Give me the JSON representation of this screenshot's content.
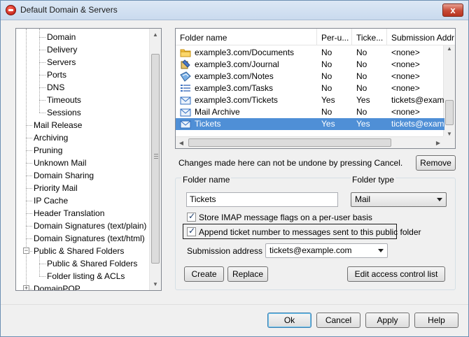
{
  "window": {
    "title": "Default Domain & Servers",
    "close_glyph": "x"
  },
  "tree": {
    "items": [
      {
        "label": "Domain",
        "level": 2
      },
      {
        "label": "Delivery",
        "level": 2
      },
      {
        "label": "Servers",
        "level": 2
      },
      {
        "label": "Ports",
        "level": 2
      },
      {
        "label": "DNS",
        "level": 2
      },
      {
        "label": "Timeouts",
        "level": 2
      },
      {
        "label": "Sessions",
        "level": 2
      },
      {
        "label": "Mail Release",
        "level": 1
      },
      {
        "label": "Archiving",
        "level": 1
      },
      {
        "label": "Pruning",
        "level": 1
      },
      {
        "label": "Unknown Mail",
        "level": 1
      },
      {
        "label": "Domain Sharing",
        "level": 1
      },
      {
        "label": "Priority Mail",
        "level": 1
      },
      {
        "label": "IP Cache",
        "level": 1
      },
      {
        "label": "Header Translation",
        "level": 1
      },
      {
        "label": "Domain Signatures (text/plain)",
        "level": 1
      },
      {
        "label": "Domain Signatures (text/html)",
        "level": 1
      },
      {
        "label": "Public & Shared Folders",
        "level": 1
      },
      {
        "label": "Public & Shared Folders",
        "level": 2
      },
      {
        "label": "Folder listing & ACLs",
        "level": 2
      },
      {
        "label": "DomainPOP",
        "level": 1
      }
    ],
    "expanders": {
      "collapse": "−",
      "expand": "+"
    }
  },
  "folders": {
    "columns": [
      "Folder name",
      "Per-u...",
      "Ticke...",
      "Submission Addr"
    ],
    "rows": [
      {
        "icon": "folder-icon",
        "name": "example3.com/Documents",
        "per_user": "No",
        "ticket": "No",
        "submission": "<none>"
      },
      {
        "icon": "journal-icon",
        "name": "example3.com/Journal",
        "per_user": "No",
        "ticket": "No",
        "submission": "<none>"
      },
      {
        "icon": "notes-icon",
        "name": "example3.com/Notes",
        "per_user": "No",
        "ticket": "No",
        "submission": "<none>"
      },
      {
        "icon": "tasks-icon",
        "name": "example3.com/Tasks",
        "per_user": "No",
        "ticket": "No",
        "submission": "<none>"
      },
      {
        "icon": "mail-icon",
        "name": "example3.com/Tickets",
        "per_user": "Yes",
        "ticket": "Yes",
        "submission": "tickets@example"
      },
      {
        "icon": "mail-icon",
        "name": "Mail Archive",
        "per_user": "No",
        "ticket": "No",
        "submission": "<none>"
      },
      {
        "icon": "mail-icon",
        "name": "Tickets",
        "per_user": "Yes",
        "ticket": "Yes",
        "submission": "tickets@example",
        "selected": true
      }
    ]
  },
  "warning_text": "Changes made here can not be undone by pressing Cancel.",
  "buttons": {
    "remove": "Remove",
    "create": "Create",
    "replace": "Replace",
    "edit_acl": "Edit access control list",
    "ok": "Ok",
    "cancel": "Cancel",
    "apply": "Apply",
    "help": "Help"
  },
  "form": {
    "folder_name_label": "Folder name",
    "folder_name_value": "Tickets",
    "folder_type_label": "Folder type",
    "folder_type_value": "Mail",
    "store_flags_label": "Store IMAP message flags on a per-user basis",
    "store_flags_checked": true,
    "append_ticket_label": "Append ticket number to messages sent to this public folder",
    "append_ticket_checked": true,
    "submission_label": "Submission address",
    "submission_value": "tickets@example.com",
    "check_glyph": "✓"
  },
  "scroll_glyphs": {
    "up": "▲",
    "down": "▼",
    "left": "◀",
    "right": "▶"
  }
}
